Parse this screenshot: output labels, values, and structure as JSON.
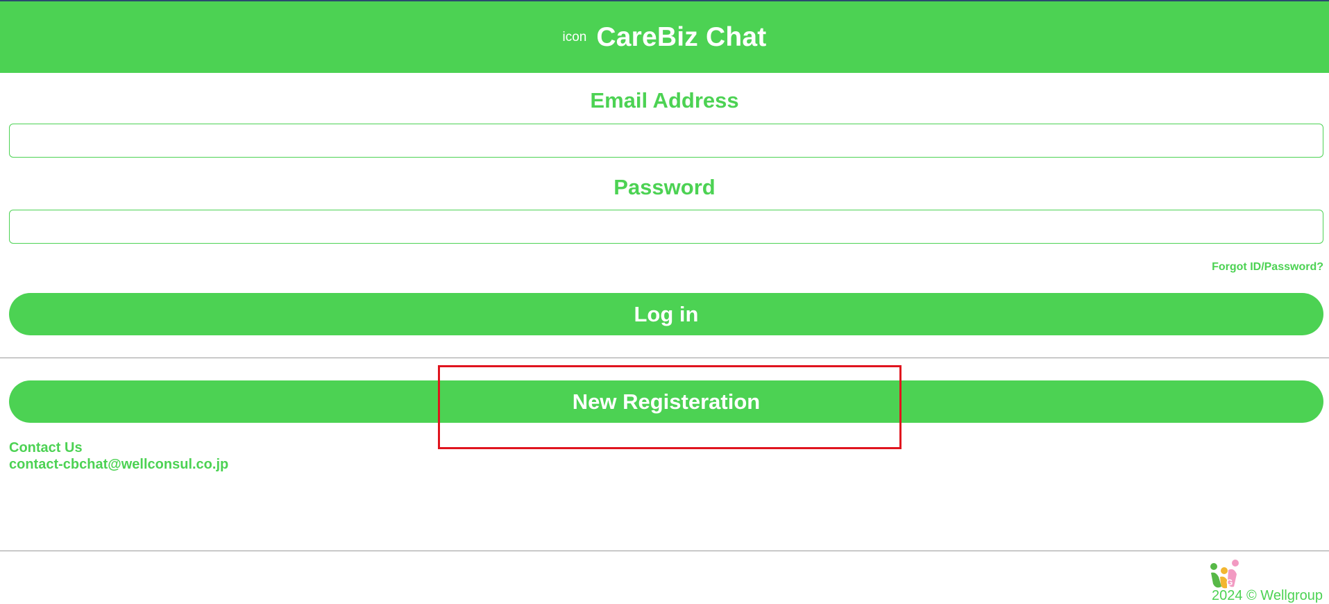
{
  "header": {
    "icon_alt": "icon",
    "title": "CareBiz Chat"
  },
  "form": {
    "email_label": "Email Address",
    "email_value": "",
    "password_label": "Password",
    "password_value": "",
    "forgot_link": "Forgot ID/Password?",
    "login_button": "Log in",
    "register_button": "New Registeration"
  },
  "contact": {
    "heading": "Contact Us",
    "email": "contact-cbchat@wellconsul.co.jp"
  },
  "footer": {
    "copyright": "2024 © Wellgroup",
    "logo_icon": "wellgroup-logo-icon"
  },
  "colors": {
    "brand_green": "#4cd253",
    "highlight_red": "#e0141e",
    "top_line": "#2b4a6f"
  }
}
